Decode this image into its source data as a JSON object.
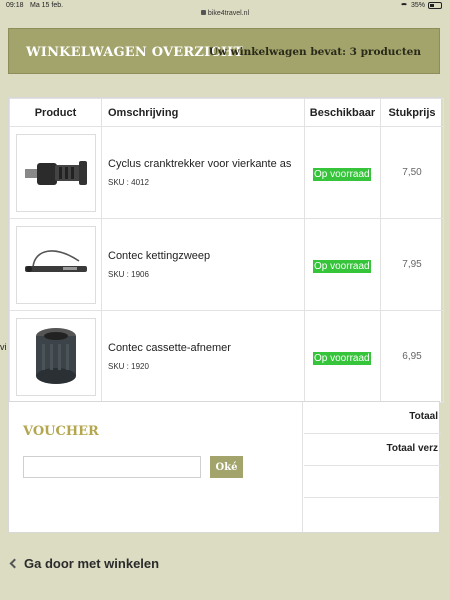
{
  "status": {
    "time": "09:18",
    "date": "Ma 15 feb.",
    "url": "bike4travel.nl",
    "battery": "35%",
    "battery_level": 0.35
  },
  "header": {
    "title": "WINKELWAGEN OVERZICHT",
    "count_text": "Uw winkelwagen bevat: 3 producten"
  },
  "table": {
    "columns": [
      "Product",
      "Omschrijving",
      "Beschikbaar",
      "Stukprijs"
    ],
    "rows": [
      {
        "name": "Cyclus cranktrekker voor vierkante as",
        "sku": "SKU : 4012",
        "availability": "Op voorraad",
        "price": "7,50",
        "icon": "crank-puller-tool-image"
      },
      {
        "name": "Contec kettingzweep",
        "sku": "SKU : 1906",
        "availability": "Op voorraad",
        "price": "7,95",
        "icon": "chain-whip-tool-image"
      },
      {
        "name": "Contec cassette-afnemer",
        "sku": "SKU : 1920",
        "availability": "Op voorraad",
        "price": "6,95",
        "icon": "cassette-remover-tool-image"
      }
    ]
  },
  "voucher": {
    "title": "VOUCHER",
    "input_value": "",
    "button_label": "Oké"
  },
  "totals": {
    "total_label": "Totaal",
    "shipping_label": "Totaal verz"
  },
  "continue_label": "Ga door met winkelen",
  "stray_text": "vi",
  "colors": {
    "background": "#dcdcc3",
    "header_bg": "#a3a46b",
    "badge_green": "#35c43a",
    "voucher_title": "#b3a64d"
  }
}
